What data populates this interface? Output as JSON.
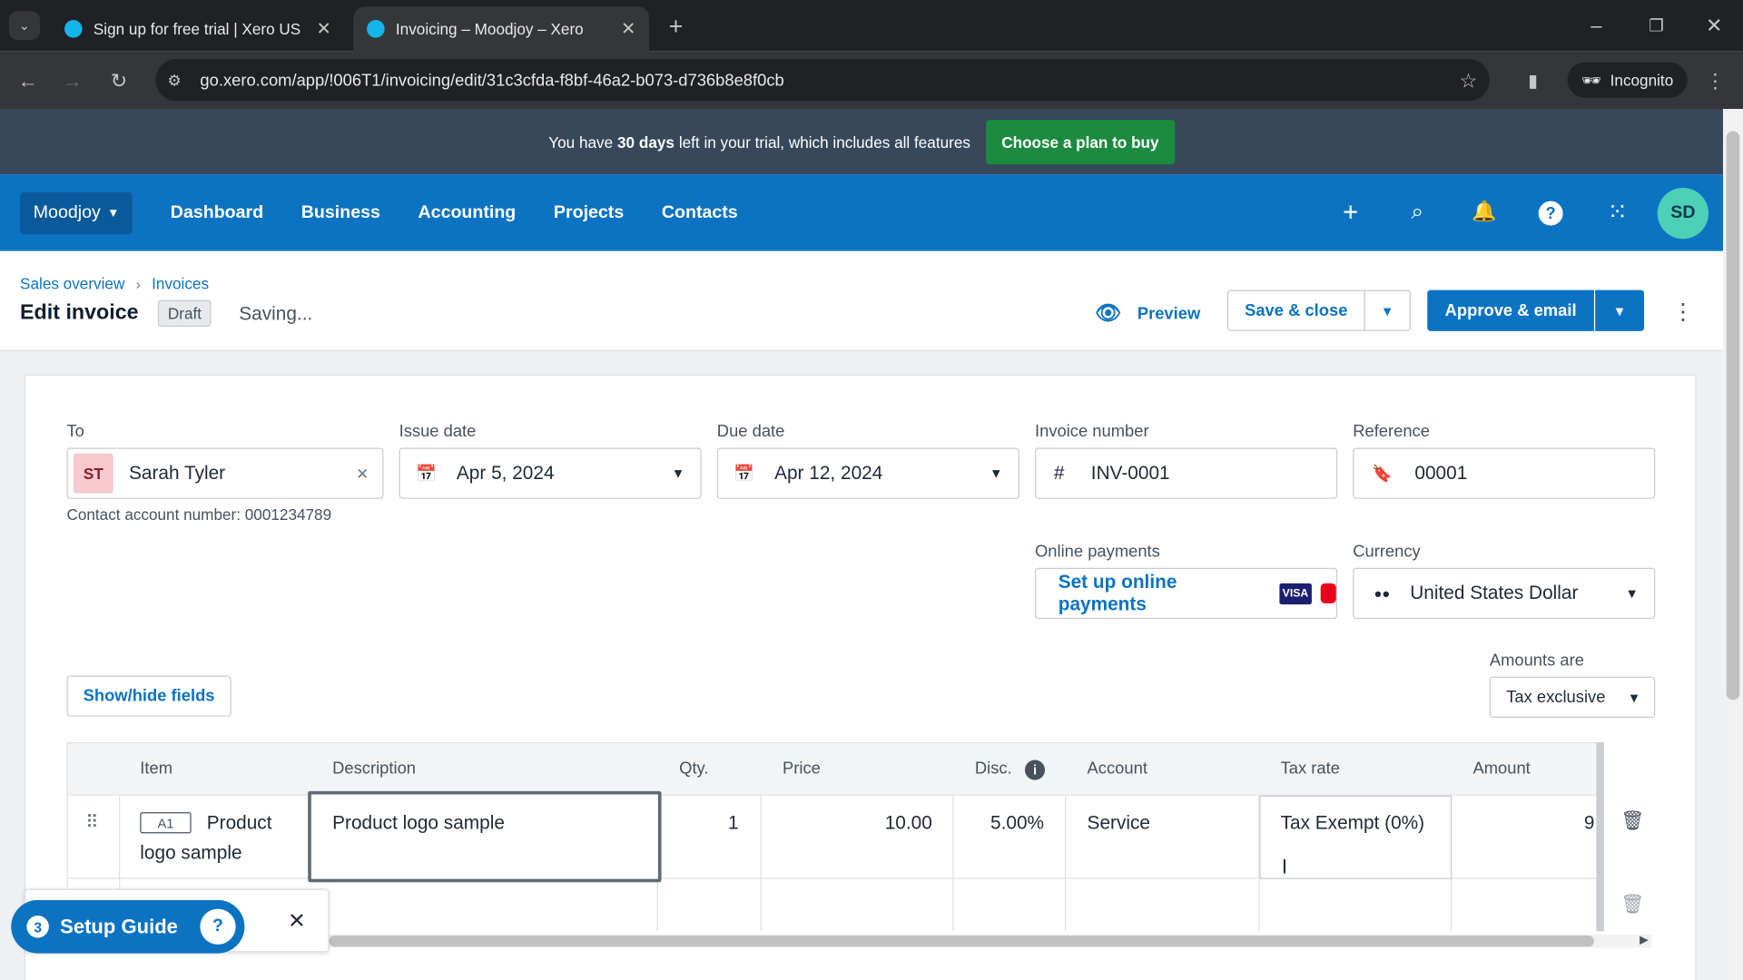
{
  "browser": {
    "tabs": [
      {
        "title": "Sign up for free trial | Xero US"
      },
      {
        "title": "Invoicing – Moodjoy – Xero"
      }
    ],
    "url": "go.xero.com/app/!006T1/invoicing/edit/31c3cfda-f8bf-46a2-b073-d736b8e8f0cb",
    "incognito_label": "Incognito"
  },
  "banner": {
    "text_before": "You have",
    "days": "30 days",
    "text_after": "left in your trial, which includes all features",
    "cta": "Choose a plan to buy"
  },
  "nav": {
    "org": "Moodjoy",
    "items": [
      "Dashboard",
      "Business",
      "Accounting",
      "Projects",
      "Contacts"
    ],
    "avatar": "SD"
  },
  "header": {
    "breadcrumb": [
      "Sales overview",
      "Invoices"
    ],
    "title": "Edit invoice",
    "status": "Draft",
    "saving": "Saving...",
    "preview": "Preview",
    "save_close": "Save & close",
    "approve_email": "Approve & email"
  },
  "form": {
    "to_label": "To",
    "to_initials": "ST",
    "to_name": "Sarah Tyler",
    "contact_account": "Contact account number: 0001234789",
    "issue_label": "Issue date",
    "issue_value": "Apr 5, 2024",
    "due_label": "Due date",
    "due_value": "Apr 12, 2024",
    "invnum_label": "Invoice number",
    "invnum_value": "INV-0001",
    "ref_label": "Reference",
    "ref_value": "00001",
    "online_label": "Online payments",
    "online_value": "Set up online payments",
    "visa": "VISA",
    "currency_label": "Currency",
    "currency_value": "United States Dollar",
    "amounts_label": "Amounts are",
    "amounts_value": "Tax exclusive",
    "showhide": "Show/hide fields"
  },
  "table": {
    "headers": [
      "Item",
      "Description",
      "Qty.",
      "Price",
      "Disc.",
      "Account",
      "Tax rate",
      "Amount"
    ],
    "row": {
      "code": "A1",
      "item_line1": "Product",
      "item_line2": "logo sample",
      "description": "Product logo sample",
      "qty": "1",
      "price": "10.00",
      "disc": "5.00%",
      "account": "Service",
      "tax": "Tax Exempt (0%)",
      "amount": "9."
    }
  },
  "setup": {
    "count": "3",
    "label": "Setup Guide"
  }
}
